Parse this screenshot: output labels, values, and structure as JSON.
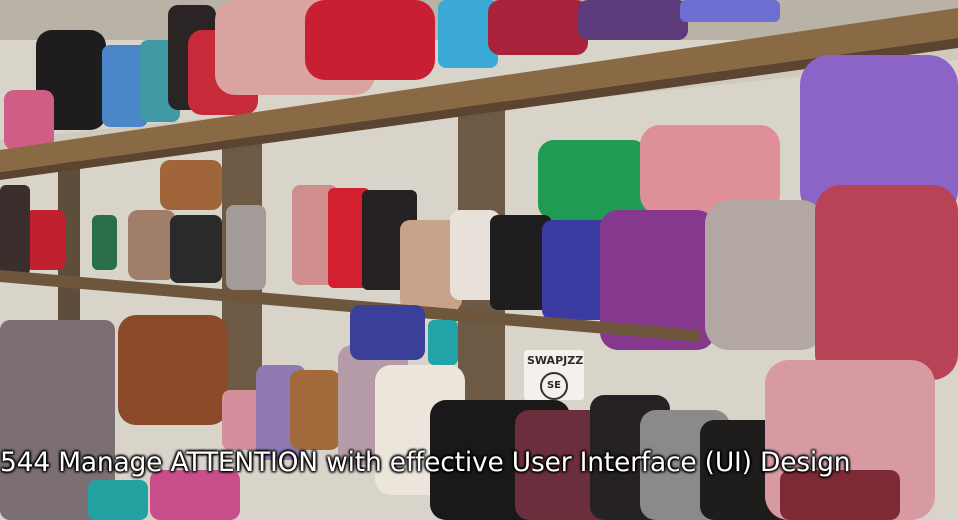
{
  "caption": "544 Manage ATTENTION with effective User Interface (UI) Design",
  "hang_tag": {
    "brand": "SWAPJZZ",
    "logo": "SE"
  },
  "colors": {
    "wall": "#d9d4ca",
    "shelf_wood": "#8a6a44",
    "caption_text": "#ffffff"
  }
}
